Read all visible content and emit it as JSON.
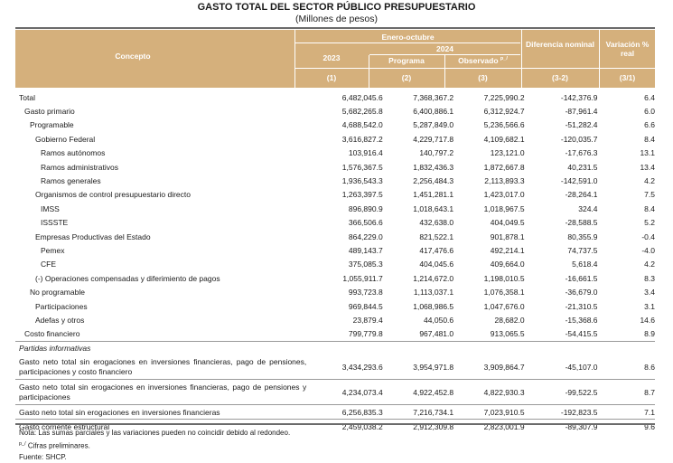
{
  "title": "GASTO TOTAL DEL SECTOR PÚBLICO PRESUPUESTARIO",
  "subtitle": "(Millones de pesos)",
  "header": {
    "concepto": "Concepto",
    "period": "Enero-octubre",
    "year_2024": "2024",
    "col_2023": "2023",
    "col_programa": "Programa",
    "col_observado": "Observado",
    "observado_sup": "p_/",
    "col_diferencia": "Diferencia nominal",
    "col_variacion": "Variación % real",
    "idx": [
      "(1)",
      "(2)",
      "(3)",
      "(3-2)",
      "(3/1)"
    ]
  },
  "rows": [
    {
      "label": "Total",
      "v2023": "6,482,045.6",
      "programa": "7,368,367.2",
      "observado": "7,225,990.2",
      "diferencia": "-142,376.9",
      "variacion": "6.4"
    },
    {
      "label": "Gasto primario",
      "v2023": "5,682,265.8",
      "programa": "6,400,886.1",
      "observado": "6,312,924.7",
      "diferencia": "-87,961.4",
      "variacion": "6.0"
    },
    {
      "label": "Programable",
      "v2023": "4,688,542.0",
      "programa": "5,287,849.0",
      "observado": "5,236,566.6",
      "diferencia": "-51,282.4",
      "variacion": "6.6"
    },
    {
      "label": "Gobierno Federal",
      "v2023": "3,616,827.2",
      "programa": "4,229,717.8",
      "observado": "4,109,682.1",
      "diferencia": "-120,035.7",
      "variacion": "8.4"
    },
    {
      "label": "Ramos autónomos",
      "v2023": "103,916.4",
      "programa": "140,797.2",
      "observado": "123,121.0",
      "diferencia": "-17,676.3",
      "variacion": "13.1"
    },
    {
      "label": "Ramos administrativos",
      "v2023": "1,576,367.5",
      "programa": "1,832,436.3",
      "observado": "1,872,667.8",
      "diferencia": "40,231.5",
      "variacion": "13.4"
    },
    {
      "label": "Ramos generales",
      "v2023": "1,936,543.3",
      "programa": "2,256,484.3",
      "observado": "2,113,893.3",
      "diferencia": "-142,591.0",
      "variacion": "4.2"
    },
    {
      "label": "Organismos de control presupuestario directo",
      "v2023": "1,263,397.5",
      "programa": "1,451,281.1",
      "observado": "1,423,017.0",
      "diferencia": "-28,264.1",
      "variacion": "7.5"
    },
    {
      "label": "IMSS",
      "v2023": "896,890.9",
      "programa": "1,018,643.1",
      "observado": "1,018,967.5",
      "diferencia": "324.4",
      "variacion": "8.4"
    },
    {
      "label": "ISSSTE",
      "v2023": "366,506.6",
      "programa": "432,638.0",
      "observado": "404,049.5",
      "diferencia": "-28,588.5",
      "variacion": "5.2"
    },
    {
      "label": "Empresas Productivas del Estado",
      "v2023": "864,229.0",
      "programa": "821,522.1",
      "observado": "901,878.1",
      "diferencia": "80,355.9",
      "variacion": "-0.4"
    },
    {
      "label": "Pemex",
      "v2023": "489,143.7",
      "programa": "417,476.6",
      "observado": "492,214.1",
      "diferencia": "74,737.5",
      "variacion": "-4.0"
    },
    {
      "label": "CFE",
      "v2023": "375,085.3",
      "programa": "404,045.6",
      "observado": "409,664.0",
      "diferencia": "5,618.4",
      "variacion": "4.2"
    },
    {
      "label": "(-) Operaciones compensadas y diferimiento de pagos",
      "v2023": "1,055,911.7",
      "programa": "1,214,672.0",
      "observado": "1,198,010.5",
      "diferencia": "-16,661.5",
      "variacion": "8.3"
    },
    {
      "label": "No programable",
      "v2023": "993,723.8",
      "programa": "1,113,037.1",
      "observado": "1,076,358.1",
      "diferencia": "-36,679.0",
      "variacion": "3.4"
    },
    {
      "label": "Participaciones",
      "v2023": "969,844.5",
      "programa": "1,068,986.5",
      "observado": "1,047,676.0",
      "diferencia": "-21,310.5",
      "variacion": "3.1"
    },
    {
      "label": "Adefas y otros",
      "v2023": "23,879.4",
      "programa": "44,050.6",
      "observado": "28,682.0",
      "diferencia": "-15,368.6",
      "variacion": "14.6"
    },
    {
      "label": "Costo financiero",
      "v2023": "799,779.8",
      "programa": "967,481.0",
      "observado": "913,065.5",
      "diferencia": "-54,415.5",
      "variacion": "8.9"
    }
  ],
  "partidas_label": "Partidas informativas",
  "partidas": [
    {
      "label": "Gasto neto total sin erogaciones en inversiones financieras, pago de pensiones, participaciones y costo financiero",
      "v2023": "3,434,293.6",
      "programa": "3,954,971.8",
      "observado": "3,909,864.7",
      "diferencia": "-45,107.0",
      "variacion": "8.6"
    },
    {
      "label": "Gasto neto total sin erogaciones en inversiones financieras, pago de pensiones y participaciones",
      "v2023": "4,234,073.4",
      "programa": "4,922,452.8",
      "observado": "4,822,930.3",
      "diferencia": "-99,522.5",
      "variacion": "8.7"
    },
    {
      "label": "Gasto neto total sin erogaciones en inversiones financieras",
      "v2023": "6,256,835.3",
      "programa": "7,216,734.1",
      "observado": "7,023,910.5",
      "diferencia": "-192,823.5",
      "variacion": "7.1"
    },
    {
      "label": "Gasto corriente estructural",
      "v2023": "2,459,038.2",
      "programa": "2,912,309.8",
      "observado": "2,823,001.9",
      "diferencia": "-89,307.9",
      "variacion": "9.6"
    }
  ],
  "notes": {
    "note1": "Nota: Las sumas parciales y las variaciones pueden no coincidir debido al redondeo.",
    "note2_sup": "p_/",
    "note2": " Cifras preliminares.",
    "source": "Fuente: SHCP."
  },
  "colors": {
    "header_bg": "#d5b07c",
    "header_text": "#ffffff",
    "rule": "#6b6b6b"
  }
}
